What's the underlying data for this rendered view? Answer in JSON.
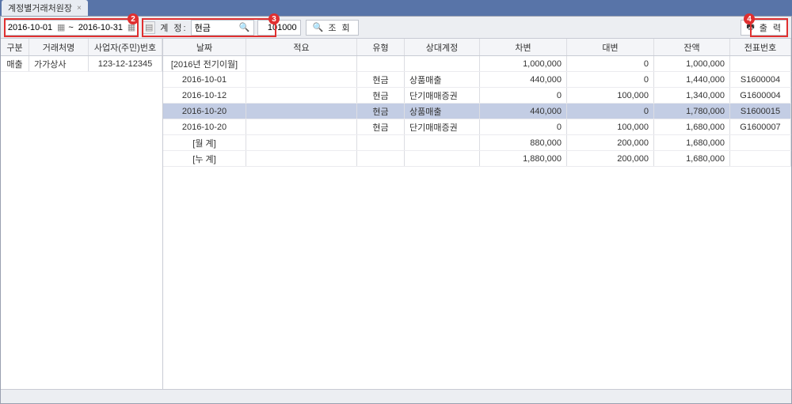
{
  "tab": {
    "title": "계정별거래처원장"
  },
  "filters": {
    "date_from": "2016-10-01",
    "date_sep": "~",
    "date_to": "2016-10-31",
    "account_label": "계 정:",
    "account_name": "현금",
    "account_code": "101000",
    "lookup": "조 회",
    "print": "출 력"
  },
  "badges": {
    "b2": "2",
    "b3": "3",
    "b4": "4"
  },
  "left": {
    "headers": [
      "구분",
      "거래처명",
      "사업자(주민)번호"
    ],
    "rows": [
      {
        "type": "매출",
        "name": "가가상사",
        "bizno": "123-12-12345"
      }
    ]
  },
  "right": {
    "headers": [
      "날짜",
      "적요",
      "유형",
      "상대계정",
      "차변",
      "대변",
      "잔액",
      "전표번호"
    ],
    "rows": [
      {
        "date": "[2016년 전기이월]",
        "memo": "",
        "type": "",
        "counter": "",
        "debit": "1,000,000",
        "credit": "0",
        "balance": "1,000,000",
        "voucher": ""
      },
      {
        "date": "2016-10-01",
        "memo": "",
        "type": "현금",
        "counter": "상품매출",
        "debit": "440,000",
        "credit": "0",
        "balance": "1,440,000",
        "voucher": "S1600004"
      },
      {
        "date": "2016-10-12",
        "memo": "",
        "type": "현금",
        "counter": "단기매매증권",
        "debit": "0",
        "credit": "100,000",
        "balance": "1,340,000",
        "voucher": "G1600004"
      },
      {
        "date": "2016-10-20",
        "memo": "",
        "type": "현금",
        "counter": "상품매출",
        "debit": "440,000",
        "credit": "0",
        "balance": "1,780,000",
        "voucher": "S1600015",
        "selected": true
      },
      {
        "date": "2016-10-20",
        "memo": "",
        "type": "현금",
        "counter": "단기매매증권",
        "debit": "0",
        "credit": "100,000",
        "balance": "1,680,000",
        "voucher": "G1600007"
      },
      {
        "date": "[월 계]",
        "memo": "",
        "type": "",
        "counter": "",
        "debit": "880,000",
        "credit": "200,000",
        "balance": "1,680,000",
        "voucher": ""
      },
      {
        "date": "[누 계]",
        "memo": "",
        "type": "",
        "counter": "",
        "debit": "1,880,000",
        "credit": "200,000",
        "balance": "1,680,000",
        "voucher": ""
      }
    ]
  }
}
